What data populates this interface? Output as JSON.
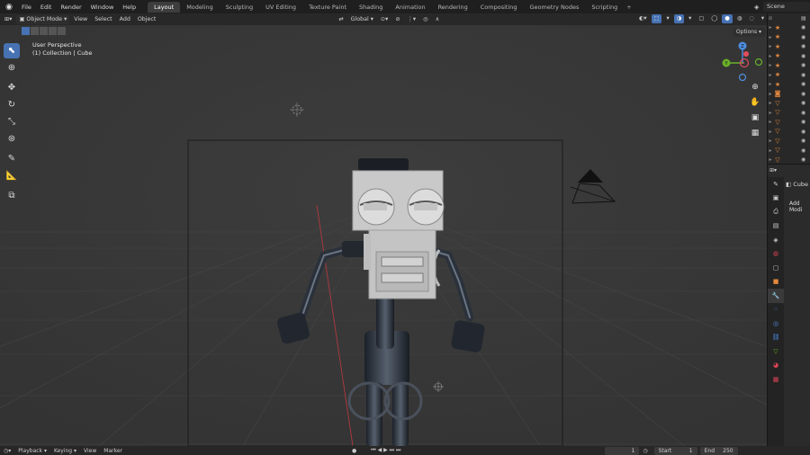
{
  "topbar": {
    "menus": [
      "File",
      "Edit",
      "Render",
      "Window",
      "Help"
    ],
    "workspaces": [
      "Layout",
      "Modeling",
      "Sculpting",
      "UV Editing",
      "Texture Paint",
      "Shading",
      "Animation",
      "Rendering",
      "Compositing",
      "Geometry Nodes",
      "Scripting"
    ],
    "active_workspace": "Layout",
    "add_workspace": "+",
    "scene_name": "Scene"
  },
  "viewport_header": {
    "mode": "Object Mode",
    "menus": [
      "View",
      "Select",
      "Add",
      "Object"
    ],
    "transform_orientation": "Global",
    "options": "Options"
  },
  "viewport": {
    "perspective_label": "User Perspective",
    "collection_label": "(1) Collection | Cube",
    "gizmo_axes": {
      "x": "X",
      "y": "Y",
      "z": "Z"
    }
  },
  "properties": {
    "object_name": "Cube",
    "add_modifier": "Add Modi"
  },
  "timeline": {
    "menus": [
      "Playback",
      "Keying",
      "View",
      "Marker"
    ],
    "current_frame": "1",
    "start_label": "Start",
    "start_value": "1",
    "end_label": "End",
    "end_value": "250"
  },
  "colors": {
    "accent": "#4772b3",
    "x_axis": "#e24d5c",
    "y_axis": "#6ab02a",
    "z_axis": "#4e8ee0",
    "object_orange": "#e2883c"
  }
}
